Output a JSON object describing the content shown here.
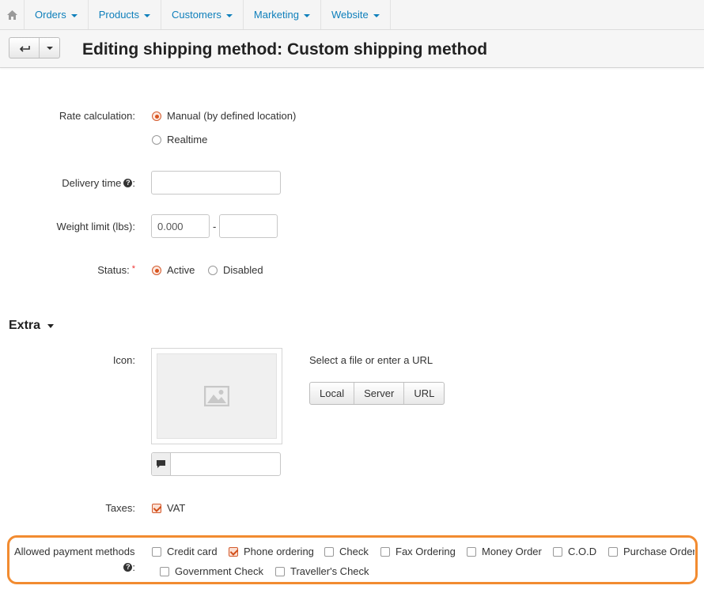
{
  "nav": {
    "items": [
      {
        "label": "Orders"
      },
      {
        "label": "Products"
      },
      {
        "label": "Customers"
      },
      {
        "label": "Marketing"
      },
      {
        "label": "Website"
      }
    ]
  },
  "header": {
    "title": "Editing shipping method: Custom shipping method"
  },
  "form": {
    "rate_calculation": {
      "label": "Rate calculation:",
      "options": [
        "Manual (by defined location)",
        "Realtime"
      ],
      "selected": "Manual (by defined location)"
    },
    "delivery_time": {
      "label": "Delivery time",
      "suffix": ":",
      "value": ""
    },
    "weight_limit": {
      "label": "Weight limit (lbs):",
      "from": "0.000",
      "separator": "-",
      "to": ""
    },
    "status": {
      "label": "Status:",
      "required_mark": "*",
      "options": [
        "Active",
        "Disabled"
      ],
      "selected": "Active"
    }
  },
  "extra": {
    "title": "Extra",
    "icon": {
      "label": "Icon:",
      "hint": "Select a file or enter a URL",
      "buttons": [
        "Local",
        "Server",
        "URL"
      ],
      "alt_value": ""
    },
    "taxes": {
      "label": "Taxes:",
      "items": [
        {
          "label": "VAT",
          "checked": true
        }
      ]
    },
    "payments": {
      "label": "Allowed payment methods",
      "suffix": ":",
      "items": [
        {
          "label": "Credit card",
          "checked": false
        },
        {
          "label": "Phone ordering",
          "checked": true
        },
        {
          "label": "Check",
          "checked": false
        },
        {
          "label": "Fax Ordering",
          "checked": false
        },
        {
          "label": "Money Order",
          "checked": false
        },
        {
          "label": "C.O.D",
          "checked": false
        },
        {
          "label": "Purchase Order",
          "checked": false
        },
        {
          "label": "Government Check",
          "checked": false
        },
        {
          "label": "Traveller's Check",
          "checked": false
        }
      ]
    }
  },
  "colors": {
    "link": "#0e7fbb",
    "accent": "#d9541e",
    "highlight": "#f28b30"
  }
}
